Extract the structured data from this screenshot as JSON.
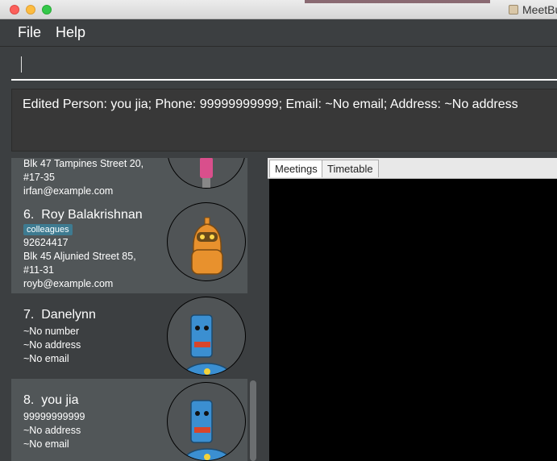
{
  "window": {
    "title": "MeetBu"
  },
  "menu": {
    "file": "File",
    "help": "Help"
  },
  "command_box": {
    "value": ""
  },
  "result_display": {
    "text": "Edited Person: you jia; Phone: 99999999999; Email: ~No email; Address: ~No address"
  },
  "persons": [
    {
      "address_line1": "Blk 47 Tampines Street 20,",
      "address_line2": "#17-35",
      "email": "irfan@example.com"
    },
    {
      "index": "6.",
      "name": "Roy Balakrishnan",
      "tag": "colleagues",
      "phone": "92624417",
      "address_line1": "Blk 45 Aljunied Street 85,",
      "address_line2": "#11-31",
      "email": "royb@example.com"
    },
    {
      "index": "7.",
      "name": "Danelynn",
      "phone": "~No number",
      "address": "~No address",
      "email": "~No email"
    },
    {
      "index": "8.",
      "name": "you jia",
      "phone": "99999999999",
      "address": "~No address",
      "email": "~No email"
    }
  ],
  "tabs": {
    "meetings": "Meetings",
    "timetable": "Timetable"
  },
  "colors": {
    "tag_bg": "#3e7b91",
    "panel_bg": "#3c3f41",
    "card_shade": "#515658",
    "tab_content_bg": "#000000"
  }
}
